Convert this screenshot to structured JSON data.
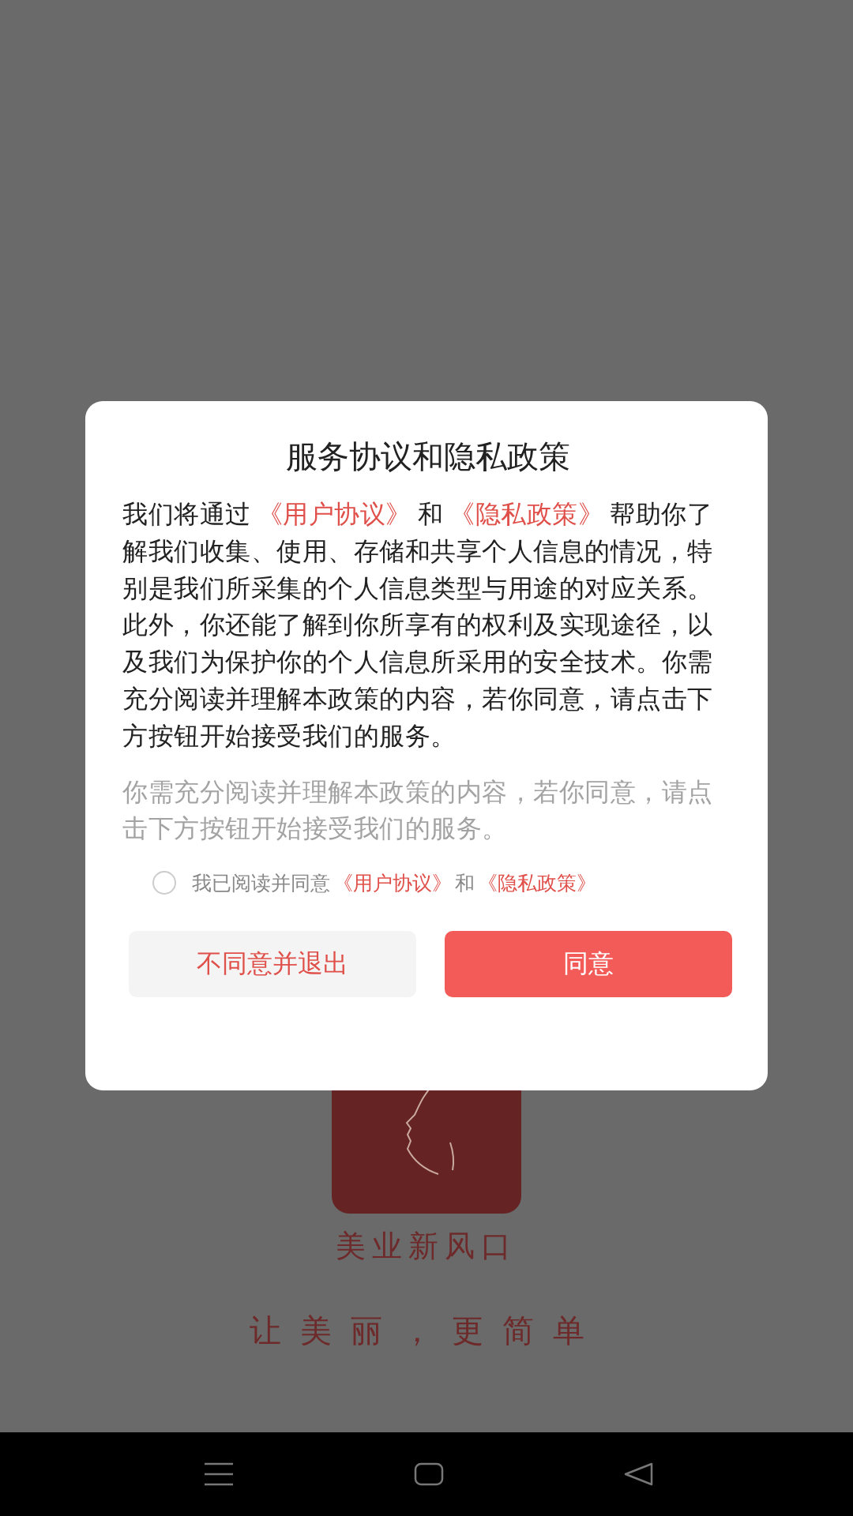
{
  "splash": {
    "app_name": "美业新风口",
    "slogan": "让美丽，更简单"
  },
  "dialog": {
    "title": "服务协议和隐私政策",
    "body": [
      {
        "kind": "text",
        "text": "我们将通过"
      },
      {
        "kind": "link",
        "text": "《用户协议》"
      },
      {
        "kind": "text",
        "text": "和"
      },
      {
        "kind": "link",
        "text": "《隐私政策》"
      },
      {
        "kind": "text",
        "text": "帮助你了解我们收集、使用、存储和共享个人信息的情况，特别是我们所采集的个人信息类型与用途的对应关系。此外，你还能了解到你所享有的权利及实现途径，以及我们为保护你的个人信息所采用的安全技术。你需充分阅读并理解本政策的内容，若你同意，请点击下方按钮开始接受我们的服务。"
      }
    ],
    "note": "你需充分阅读并理解本政策的内容，若你同意，请点击下方按钮开始接受我们的服务。",
    "consent": {
      "checked": false,
      "parts": [
        {
          "kind": "text",
          "text": "我已阅读并同意"
        },
        {
          "kind": "link",
          "text": "《用户协议》"
        },
        {
          "kind": "text",
          "text": "和"
        },
        {
          "kind": "link",
          "text": "《隐私政策》"
        }
      ]
    },
    "buttons": [
      {
        "kind": "secondary",
        "label": "不同意并退出"
      },
      {
        "kind": "primary",
        "label": "同意"
      }
    ]
  }
}
